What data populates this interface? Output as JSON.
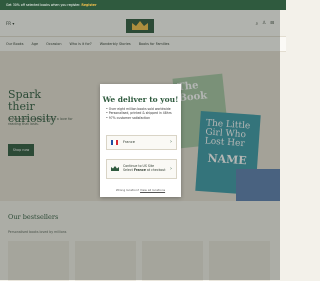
{
  "promo": {
    "text": "Get 30% off selected books when you register.",
    "highlight": "Register"
  },
  "header": {
    "language": "FR",
    "search_glyph": "⌕",
    "account_glyph": "♙",
    "cart_glyph": "⊟",
    "logo_icon": "crown-logo"
  },
  "nav": {
    "items": [
      "Our Books",
      "Age",
      "Occasion",
      "Who is it for?",
      "Wonderbly Stories",
      "Books for Families"
    ]
  },
  "hero": {
    "title": "Spark their curiosity",
    "subtitle": "Personalised books to ignite a love for reading that lasts.",
    "button": "Shop now",
    "book1_title": "The Book",
    "book2_title_top": "The Little Girl Who Lost Her",
    "book2_title_bottom": "NAME"
  },
  "bestsellers": {
    "title": "Our bestsellers",
    "subtitle": "Personalised books loved by millions"
  },
  "modal": {
    "title": "We deliver to you!",
    "bullets": [
      "• Over eight million books sold worldwide",
      "• Personalised, printed & shipped in 48hrs",
      "• 97% customer satisfaction"
    ],
    "option_france": "France",
    "option_us_line1": "Continue to US Site",
    "option_us_line2_prefix": "Select ",
    "option_us_line2_bold": "France",
    "option_us_line2_suffix": " at checkout",
    "footer_prefix": "Wrong location? ",
    "footer_link": "View all locations",
    "chevron": "›"
  },
  "colors": {
    "brand_green": "#2f5a3e",
    "promo_highlight": "#f3c04b",
    "flag_blue": "#1f4ea1",
    "flag_red": "#d62a35"
  }
}
